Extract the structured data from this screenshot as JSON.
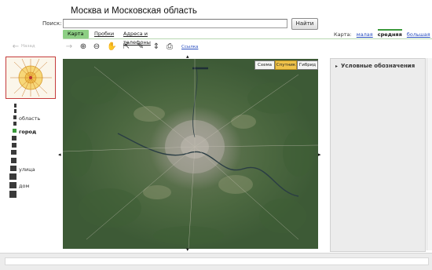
{
  "header": {
    "title": "Москва и Московская область"
  },
  "search": {
    "label": "Поиск:",
    "value": "",
    "button": "Найти"
  },
  "tabs": [
    {
      "label": "Карта",
      "active": true
    },
    {
      "label": "Пробки",
      "active": false
    },
    {
      "label": "Адреса и телефоны",
      "active": false
    }
  ],
  "map_size": {
    "label": "Карта:",
    "options": [
      "малая",
      "средняя",
      "большая"
    ],
    "selected": "средняя"
  },
  "toolbar": {
    "back_label": "Назад",
    "link_label": "Ссылка",
    "tools": [
      "back-arrow-icon",
      "forward-arrow-icon",
      "zoom-in-icon",
      "zoom-out-icon",
      "hand-pan-icon",
      "select-cursor-icon",
      "ruler-icon",
      "updown-arrows-icon",
      "print-icon"
    ]
  },
  "zoom_scale": {
    "labels": [
      "область",
      "город",
      "улица",
      "дом"
    ],
    "current": "город"
  },
  "map_types": {
    "options": [
      "Схема",
      "Спутник",
      "Гибрид"
    ],
    "selected": "Спутник"
  },
  "legend": {
    "title": "Условные обозначения"
  },
  "colors": {
    "accent_green": "#8dcf84",
    "selected_type": "#f0c34a",
    "link_blue": "#2a4fc0"
  }
}
